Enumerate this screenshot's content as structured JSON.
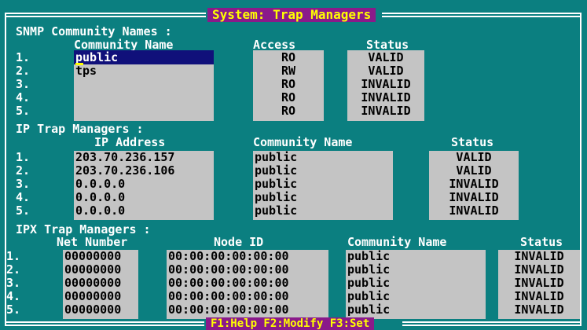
{
  "window": {
    "title": "System: Trap Managers"
  },
  "snmp": {
    "heading": "SNMP Community Names :",
    "col_name": "Community Name",
    "col_access": "Access",
    "col_status": "Status",
    "rows": [
      {
        "num": "1.",
        "name": "public",
        "access": "RO",
        "status": "VALID"
      },
      {
        "num": "2.",
        "name": "tps",
        "access": "RW",
        "status": "VALID"
      },
      {
        "num": "3.",
        "name": "",
        "access": "RO",
        "status": "INVALID"
      },
      {
        "num": "4.",
        "name": "",
        "access": "RO",
        "status": "INVALID"
      },
      {
        "num": "5.",
        "name": "",
        "access": "RO",
        "status": "INVALID"
      }
    ]
  },
  "ip": {
    "heading": "IP Trap Managers :",
    "col_addr": "IP Address",
    "col_comm": "Community Name",
    "col_status": "Status",
    "rows": [
      {
        "num": "1.",
        "addr": "203.70.236.157",
        "comm": "public",
        "status": "VALID"
      },
      {
        "num": "2.",
        "addr": "203.70.236.106",
        "comm": "public",
        "status": "VALID"
      },
      {
        "num": "3.",
        "addr": "0.0.0.0",
        "comm": "public",
        "status": "INVALID"
      },
      {
        "num": "4.",
        "addr": "0.0.0.0",
        "comm": "public",
        "status": "INVALID"
      },
      {
        "num": "5.",
        "addr": "0.0.0.0",
        "comm": "public",
        "status": "INVALID"
      }
    ]
  },
  "ipx": {
    "heading": "IPX Trap Managers :",
    "col_net": "Net Number",
    "col_node": "Node ID",
    "col_comm": "Community Name",
    "col_status": "Status",
    "rows": [
      {
        "num": "1.",
        "net": "00000000",
        "node": "00:00:00:00:00:00",
        "comm": "public",
        "status": "INVALID"
      },
      {
        "num": "2.",
        "net": "00000000",
        "node": "00:00:00:00:00:00",
        "comm": "public",
        "status": "INVALID"
      },
      {
        "num": "3.",
        "net": "00000000",
        "node": "00:00:00:00:00:00",
        "comm": "public",
        "status": "INVALID"
      },
      {
        "num": "4.",
        "net": "00000000",
        "node": "00:00:00:00:00:00",
        "comm": "public",
        "status": "INVALID"
      },
      {
        "num": "5.",
        "net": "00000000",
        "node": "00:00:00:00:00:00",
        "comm": "public",
        "status": "INVALID"
      }
    ]
  },
  "footer": {
    "keys": "F1:Help F2:Modify F3:Set"
  },
  "colors": {
    "background": "#0b7f80",
    "field": "#c4c4c4",
    "selection": "#10107a",
    "title_bg": "#8a1a8a",
    "title_fg": "#ffff00"
  }
}
